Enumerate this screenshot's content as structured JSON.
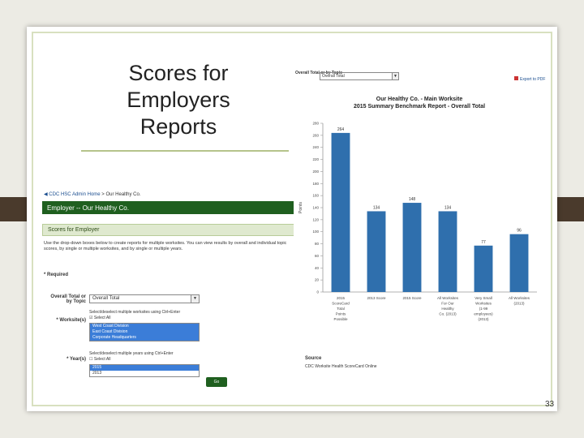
{
  "slide": {
    "title_lines": [
      "Scores for",
      "Employers",
      "Reports"
    ],
    "number": "33"
  },
  "admin": {
    "breadcrumb_link": "◀ CDC HSC Admin Home",
    "breadcrumb_sep": " > ",
    "breadcrumb_current": "Our Healthy Co.",
    "header": "Employer -- Our Healthy Co.",
    "subheader": "Scores for Employer",
    "description": "Use the drop-down boxes below to create reports for multiple worksites. You can view results by overall and individual topic scores, by single or multiple worksites, and by single or multiple years.",
    "required_label": "* Required",
    "overall_label": "Overall Total or by Topic",
    "overall_value": "Overall Total",
    "worksite_label": "* Worksite(s)",
    "worksite_hint": "Select/deselect multiple worksites using Ctrl+Enter",
    "worksite_select_all": "Select All",
    "worksites": [
      "West Coast Division",
      "East Coast Division",
      "Corporate Headquarters"
    ],
    "year_label": "* Year(s)",
    "year_hint": "Select/deselect multiple years using Ctrl+Enter",
    "year_select_all": "Select All",
    "years": [
      "2015",
      "2013"
    ],
    "go_label": "Go"
  },
  "report": {
    "control_label": "Overall Total or by Topic",
    "control_value": "Overall Total",
    "export_label": "Export to PDF",
    "title_line1": "Our Healthy Co. - Main Worksite",
    "title_line2": "2015 Summary Benchmark Report - Overall Total",
    "source_label": "Source",
    "source_text": "CDC Worksite Health ScoreCard Online"
  },
  "chart_data": {
    "type": "bar",
    "categories": [
      "2015 ScoreCard Total Points Possible",
      "2013 Score",
      "2015 Score",
      "All Worksites For Our Healthy Co. (2013)",
      "Very Small Worksites (1-99 employees) (2013)",
      "All Worksites (2013)"
    ],
    "category_lines": [
      [
        "2015",
        "ScoreCard",
        "Total",
        "Points",
        "Possible"
      ],
      [
        "2013 Score"
      ],
      [
        "2015 Score"
      ],
      [
        "All Worksites",
        "For Our",
        "Healthy",
        "Co. (2013)"
      ],
      [
        "Very Small",
        "Worksites",
        "(1-99",
        "employees)",
        "(2013)"
      ],
      [
        "All Worksites",
        "(2013)"
      ]
    ],
    "values": [
      264,
      134,
      148,
      134,
      77,
      96
    ],
    "value_labels": [
      "264",
      "134",
      "148",
      "134",
      "77",
      "96"
    ],
    "ylabel": "Points",
    "ylim": [
      0,
      280
    ],
    "yticks": [
      0,
      20,
      40,
      60,
      80,
      100,
      120,
      140,
      160,
      180,
      200,
      220,
      240,
      260,
      280
    ],
    "bar_color": "#2f6fad",
    "grid": false
  }
}
